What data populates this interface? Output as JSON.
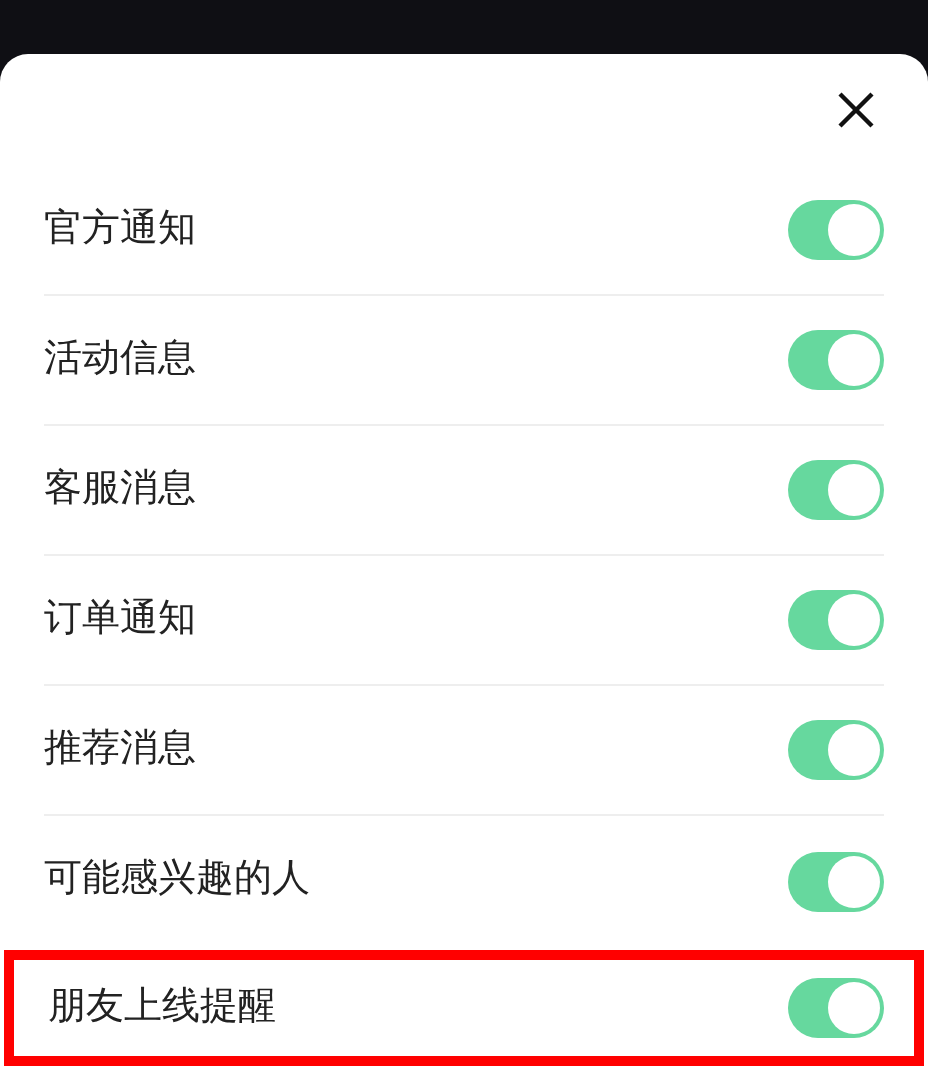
{
  "items": [
    {
      "label": "官方通知",
      "on": true,
      "highlighted": false
    },
    {
      "label": "活动信息",
      "on": true,
      "highlighted": false
    },
    {
      "label": "客服消息",
      "on": true,
      "highlighted": false
    },
    {
      "label": "订单通知",
      "on": true,
      "highlighted": false
    },
    {
      "label": "推荐消息",
      "on": true,
      "highlighted": false
    },
    {
      "label": "可能感兴趣的人",
      "on": true,
      "highlighted": false
    },
    {
      "label": "朋友上线提醒",
      "on": true,
      "highlighted": true
    }
  ]
}
